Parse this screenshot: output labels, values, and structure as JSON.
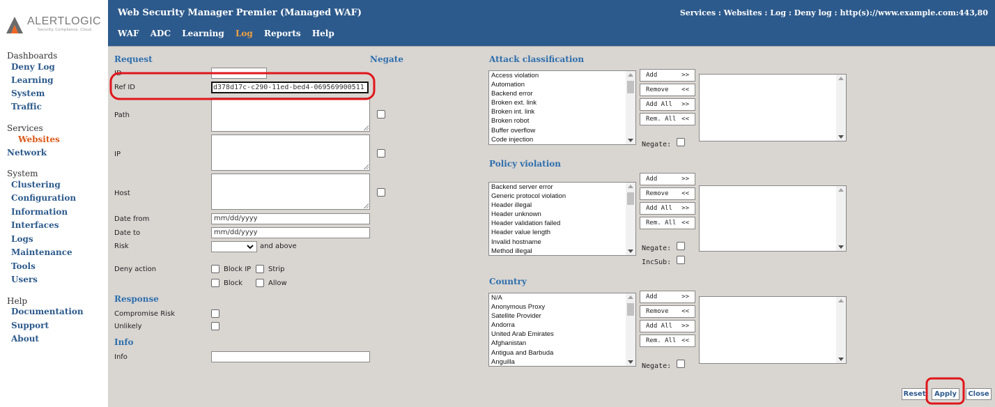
{
  "logo": {
    "name": "ALERTLOGIC",
    "tagline": "Security. Compliance. Cloud."
  },
  "header": {
    "title": "Web Security Manager Premier (Managed WAF)",
    "breadcrumb": "Services : Websites : Log : Deny log :  http(s)://www.example.com:443,80",
    "nav": [
      {
        "label": "WAF"
      },
      {
        "label": "ADC"
      },
      {
        "label": "Learning"
      },
      {
        "label": "Log"
      },
      {
        "label": "Reports"
      },
      {
        "label": "Help"
      }
    ],
    "active_color": "#f0a040"
  },
  "sidebar": {
    "dashboards": {
      "heading": "Dashboards",
      "items": [
        "Deny Log",
        "Learning",
        "System",
        "Traffic"
      ]
    },
    "services": {
      "heading": "Services",
      "items": [
        "Websites",
        "Network"
      ]
    },
    "system": {
      "heading": "System",
      "items": [
        "Clustering",
        "Configuration",
        "Information",
        "Interfaces",
        "Logs",
        "Maintenance",
        "Tools",
        "Users"
      ]
    },
    "help": {
      "heading": "Help",
      "items": [
        "Documentation",
        "Support",
        "About"
      ]
    }
  },
  "request": {
    "heading": "Request",
    "negate_heading": "Negate",
    "id_label": "ID",
    "id_value": "",
    "refid_label": "Ref ID",
    "refid_value": "d378d17c-c290-11ed-bed4-069569900511",
    "path_label": "Path",
    "ip_label": "IP",
    "host_label": "Host",
    "date_from_label": "Date from",
    "date_from_placeholder": "mm/dd/yyyy",
    "date_to_label": "Date to",
    "date_to_placeholder": "mm/dd/yyyy",
    "risk_label": "Risk",
    "risk_value": "",
    "risk_suffix": "and above",
    "deny_action_label": "Deny action",
    "deny_opts": {
      "block_ip": "Block IP",
      "strip": "Strip",
      "block": "Block",
      "allow": "Allow"
    }
  },
  "response": {
    "heading": "Response",
    "compromise_label": "Compromise Risk",
    "unlikely_label": "Unlikely"
  },
  "info": {
    "heading": "Info",
    "info_label": "Info",
    "info_value": ""
  },
  "attack": {
    "heading": "Attack classification",
    "options": [
      "Access violation",
      "Automation",
      "Backend error",
      "Broken ext. link",
      "Broken int. link",
      "Broken robot",
      "Buffer overflow",
      "Code injection"
    ],
    "negate_label": "Negate:"
  },
  "policy": {
    "heading": "Policy violation",
    "options": [
      "Backend server error",
      "Generic protocol violation",
      "Header illegal",
      "Header unknown",
      "Header validation failed",
      "Header value length",
      "Invalid hostname",
      "Method illegal"
    ],
    "negate_label": "Negate:",
    "incsub_label": "IncSub:"
  },
  "country": {
    "heading": "Country",
    "options": [
      "N/A",
      "Anonymous Proxy",
      "Satellite Provider",
      "Andorra",
      "United Arab Emirates",
      "Afghanistan",
      "Antigua and Barbuda",
      "Anguilla"
    ],
    "negate_label": "Negate:"
  },
  "move_buttons": {
    "add": "Add",
    "add_arrow": ">>",
    "remove": "Remove",
    "remove_arrow": "<<",
    "add_all": "Add All",
    "add_all_arrow": ">>",
    "rem_all": "Rem. All",
    "rem_all_arrow": "<<"
  },
  "actions": {
    "reset": "Reset",
    "apply": "Apply",
    "close": "Close"
  },
  "annotation_color": "#e0161b"
}
